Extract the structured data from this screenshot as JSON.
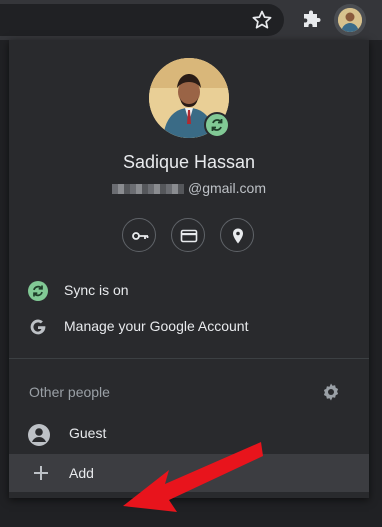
{
  "toolbar": {
    "bookmark_icon": "star-icon",
    "extensions_icon": "puzzle-icon",
    "profile_icon": "avatar-icon"
  },
  "profile": {
    "name": "Sadique Hassan",
    "email_suffix": "@gmail.com",
    "sync_badge_color": "#81c995"
  },
  "quick_actions": [
    {
      "icon": "key-icon"
    },
    {
      "icon": "credit-card-icon"
    },
    {
      "icon": "location-pin-icon"
    }
  ],
  "menu": {
    "sync_label": "Sync is on",
    "manage_label": "Manage your Google Account"
  },
  "other_people": {
    "title": "Other people",
    "guest_label": "Guest",
    "add_label": "Add"
  },
  "colors": {
    "panel": "#292a2d",
    "toolbar": "#35363a",
    "accent_green": "#81c995",
    "arrow_red": "#e8141c"
  }
}
